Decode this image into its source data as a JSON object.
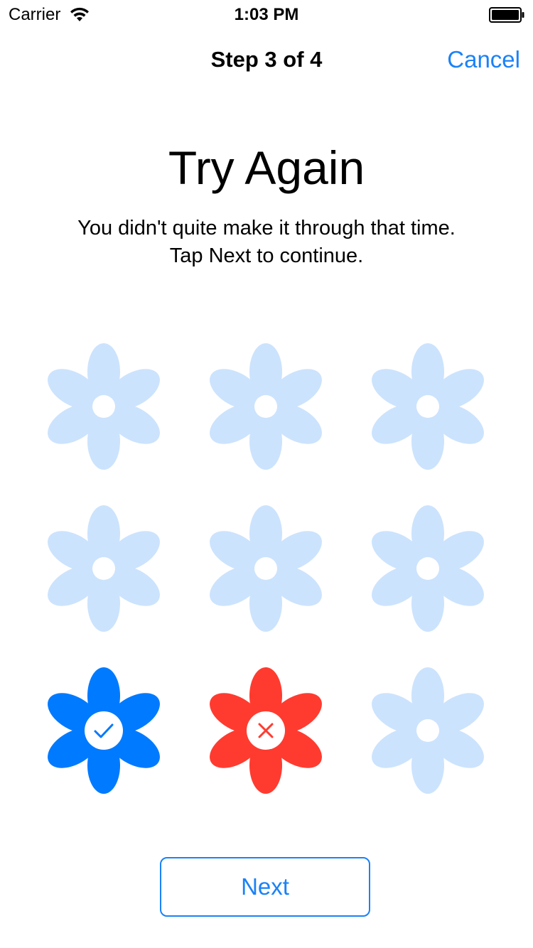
{
  "status_bar": {
    "carrier": "Carrier",
    "time": "1:03 PM",
    "wifi_icon": "wifi-icon",
    "battery_icon": "battery-full-icon"
  },
  "nav": {
    "title": "Step 3 of 4",
    "cancel_label": "Cancel"
  },
  "content": {
    "heading": "Try Again",
    "message_line1": "You didn't quite make it through that time.",
    "message_line2": "Tap Next to continue."
  },
  "grid": {
    "rows": 3,
    "columns": 3,
    "flowers": [
      {
        "state": "inactive"
      },
      {
        "state": "inactive"
      },
      {
        "state": "inactive"
      },
      {
        "state": "inactive"
      },
      {
        "state": "inactive"
      },
      {
        "state": "inactive"
      },
      {
        "state": "correct",
        "icon": "checkmark-icon"
      },
      {
        "state": "incorrect",
        "icon": "x-icon"
      },
      {
        "state": "inactive"
      }
    ]
  },
  "colors": {
    "accent": "#1a82f7",
    "flower_inactive": "#cce3fd",
    "flower_correct": "#007aff",
    "flower_incorrect": "#ff3b30",
    "text": "#000000",
    "background": "#ffffff"
  },
  "next_button": {
    "label": "Next"
  }
}
